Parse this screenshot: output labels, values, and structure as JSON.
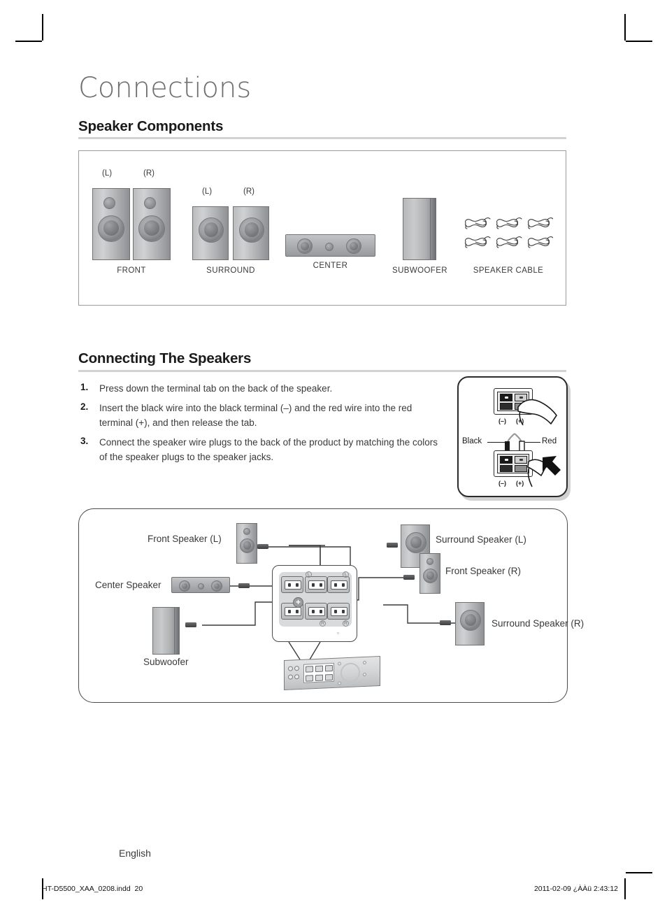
{
  "page": {
    "chapter_title": "Connections",
    "language": "English"
  },
  "sections": {
    "speaker_components": {
      "heading": "Speaker Components",
      "items": [
        {
          "caption": "FRONT",
          "channels": [
            "(L)",
            "(R)"
          ]
        },
        {
          "caption": "SURROUND",
          "channels": [
            "(L)",
            "(R)"
          ]
        },
        {
          "caption": "CENTER",
          "channels": []
        },
        {
          "caption": "SUBWOOFER",
          "channels": []
        },
        {
          "caption": "SPEAKER CABLE",
          "channels": []
        }
      ]
    },
    "connecting_the_speakers": {
      "heading": "Connecting The Speakers",
      "steps": [
        {
          "num": "1.",
          "text": "Press down the terminal tab on the back of the speaker."
        },
        {
          "num": "2.",
          "text": "Insert the black wire into the black terminal (–) and the red wire into the red terminal (+), and then release the tab."
        },
        {
          "num": "3.",
          "text": "Connect the speaker wire plugs to the back of the product by matching the colors of the speaker plugs to the speaker jacks."
        }
      ],
      "detail_illustration": {
        "minus_label_top": "(–)",
        "plus_label_top": "(+)",
        "minus_label_bottom": "(–)",
        "plus_label_bottom": "(+)",
        "black_wire_label": "Black",
        "red_wire_label": "Red"
      }
    },
    "connection_diagram": {
      "labels": {
        "front_left": "Front Speaker (L)",
        "center": "Center Speaker",
        "subwoofer": "Subwoofer",
        "surround_left": "Surround Speaker (L)",
        "front_right": "Front Speaker (R)",
        "surround_right": "Surround Speaker (R)"
      },
      "jack_marks": {
        "top_center": "L",
        "top_right": "L",
        "bottom_center": "R",
        "bottom_right": "R",
        "subwoofer_mark": "▫",
        "plus_badge": "+"
      }
    }
  },
  "footer": {
    "file_name": "HT-D5500_XAA_0208.indd",
    "page_number": "20",
    "timestamp": "2011-02-09   ¿ÀÀü 2:43:12"
  },
  "colors": {
    "rule": "#d2d2d4",
    "panel_border": "#9a9a9a",
    "diagram_border": "#4a4a4a",
    "text": "#3a3a3a",
    "title": "#6e6e6e"
  }
}
